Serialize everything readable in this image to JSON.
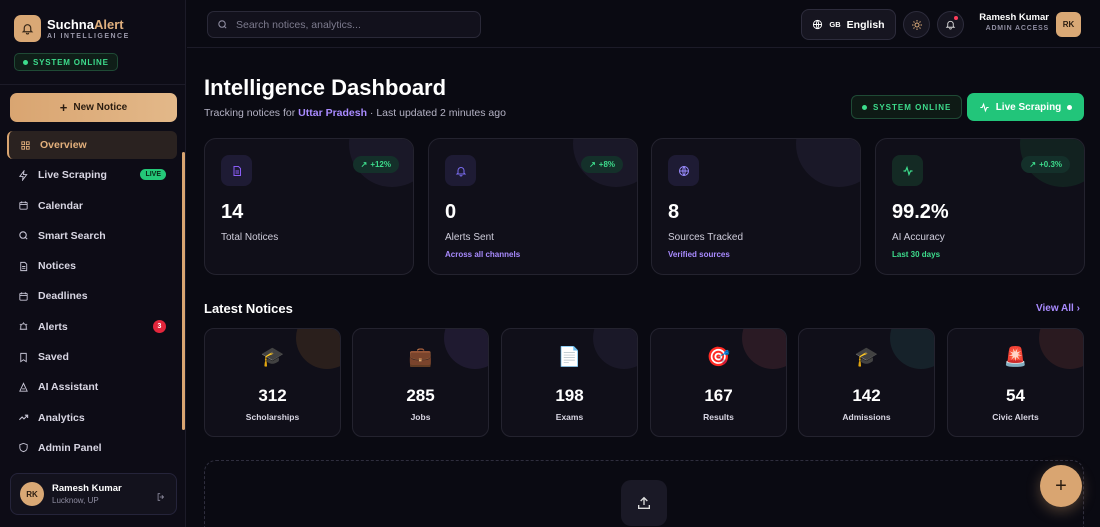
{
  "brand": {
    "name_part1": "Suchna",
    "name_part2": "Alert",
    "tagline": "AI INTELLIGENCE",
    "status": "SYSTEM ONLINE"
  },
  "sidebar": {
    "new_notice_label": "New Notice",
    "items": [
      {
        "label": "Overview",
        "icon": "grid-icon",
        "active": true
      },
      {
        "label": "Live Scraping",
        "icon": "bolt-icon",
        "badge": "LIVE"
      },
      {
        "label": "Calendar",
        "icon": "calendar-icon"
      },
      {
        "label": "Smart Search",
        "icon": "search-icon"
      },
      {
        "label": "Notices",
        "icon": "document-icon"
      },
      {
        "label": "Deadlines",
        "icon": "calendar-icon"
      },
      {
        "label": "Alerts",
        "icon": "alarm-icon",
        "badge": "3"
      },
      {
        "label": "Saved",
        "icon": "bookmark-icon"
      },
      {
        "label": "AI Assistant",
        "icon": "robot-icon"
      },
      {
        "label": "Analytics",
        "icon": "trend-icon"
      },
      {
        "label": "Admin Panel",
        "icon": "shield-icon"
      }
    ],
    "user": {
      "initials": "RK",
      "name": "Ramesh Kumar",
      "location": "Lucknow, UP"
    }
  },
  "topbar": {
    "search_placeholder": "Search notices, analytics...",
    "lang_code": "GB",
    "lang_label": "English",
    "user_name": "Ramesh Kumar",
    "user_role": "ADMIN ACCESS",
    "user_initials": "RK"
  },
  "main": {
    "title": "Intelligence Dashboard",
    "subtitle_prefix": "Tracking notices for ",
    "region": "Uttar Pradesh",
    "subtitle_suffix": " · Last updated 2 minutes ago",
    "status": "SYSTEM ONLINE",
    "live_button": "Live Scraping"
  },
  "stats": [
    {
      "value": "14",
      "label": "Total Notices",
      "trend": "+12%",
      "sub": "",
      "icon": "document-icon",
      "color": "#8a5cf6"
    },
    {
      "value": "0",
      "label": "Alerts Sent",
      "trend": "+8%",
      "sub": "Across all channels",
      "icon": "bell-icon",
      "color": "#7a6cf0"
    },
    {
      "value": "8",
      "label": "Sources Tracked",
      "trend": "",
      "sub": "Verified sources",
      "icon": "globe-icon",
      "color": "#9a8cff"
    },
    {
      "value": "99.2%",
      "label": "AI Accuracy",
      "trend": "+0.3%",
      "sub": "Last 30 days",
      "icon": "activity-icon",
      "color": "#3ddc8c"
    }
  ],
  "latest": {
    "title": "Latest Notices",
    "view_all": "View All",
    "categories": [
      {
        "emoji": "🎓",
        "value": "312",
        "label": "Scholarships"
      },
      {
        "emoji": "💼",
        "value": "285",
        "label": "Jobs"
      },
      {
        "emoji": "📄",
        "value": "198",
        "label": "Exams"
      },
      {
        "emoji": "🎯",
        "value": "167",
        "label": "Results"
      },
      {
        "emoji": "🎓",
        "value": "142",
        "label": "Admissions"
      },
      {
        "emoji": "🚨",
        "value": "54",
        "label": "Civic Alerts"
      }
    ]
  }
}
